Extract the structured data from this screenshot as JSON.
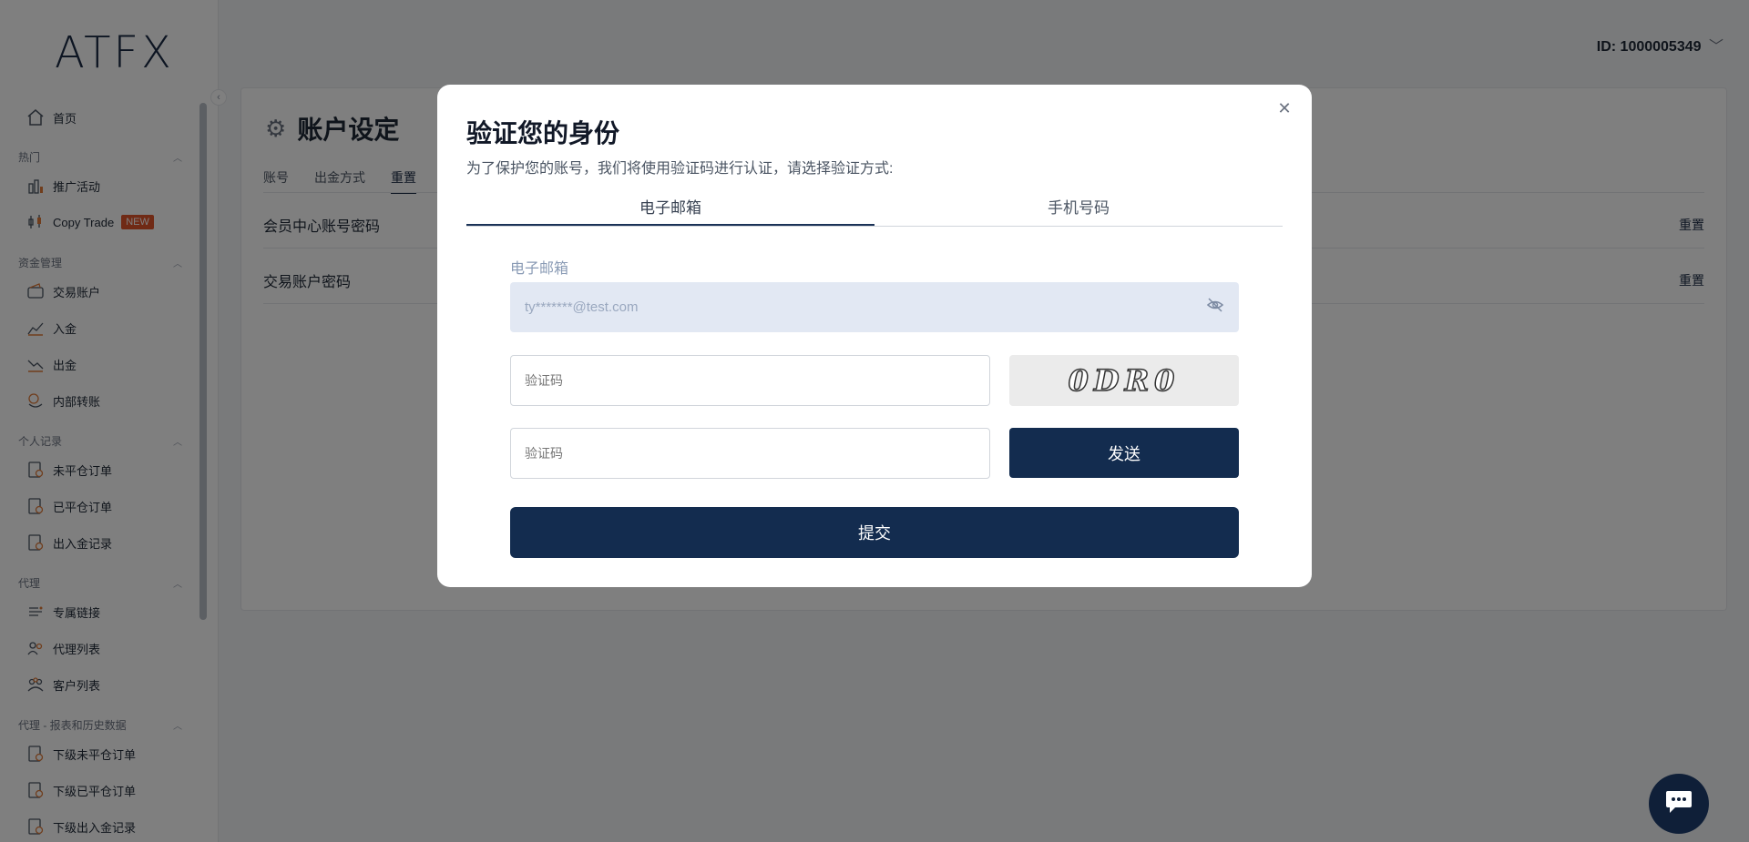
{
  "brand": {
    "logo_text": "ATFX"
  },
  "header": {
    "user_id": "ID: 1000005349"
  },
  "sidebar": {
    "home": "首页",
    "sections": [
      {
        "title": "热门",
        "items": [
          "推广活动",
          "Copy Trade"
        ]
      },
      {
        "title": "资金管理",
        "items": [
          "交易账户",
          "入金",
          "出金",
          "内部转账"
        ]
      },
      {
        "title": "个人记录",
        "items": [
          "未平仓订单",
          "已平仓订单",
          "出入金记录"
        ]
      },
      {
        "title": "代理",
        "items": [
          "专属链接",
          "代理列表",
          "客户列表"
        ]
      },
      {
        "title": "代理 - 报表和历史数据",
        "items": [
          "下级未平仓订单",
          "下级已平仓订单",
          "下级出入金记录"
        ]
      }
    ],
    "copy_trade_badge": "NEW"
  },
  "page": {
    "title": "账户设定",
    "tabs": [
      "账号",
      "出金方式",
      "重置"
    ],
    "rows": [
      {
        "label": "会员中心账号密码",
        "action": "重置"
      },
      {
        "label": "交易账户密码",
        "action": "重置"
      }
    ]
  },
  "modal": {
    "title": "验证您的身份",
    "subtitle": "为了保护您的账号，我们将使用验证码进行认证，请选择验证方式:",
    "tabs": [
      "电子邮箱",
      "手机号码"
    ],
    "email_label": "电子邮箱",
    "email_value": "ty*******@test.com",
    "captcha_placeholder": "验证码",
    "captcha_image_text": "0DR0",
    "code_placeholder": "验证码",
    "send_label": "发送",
    "submit_label": "提交"
  }
}
